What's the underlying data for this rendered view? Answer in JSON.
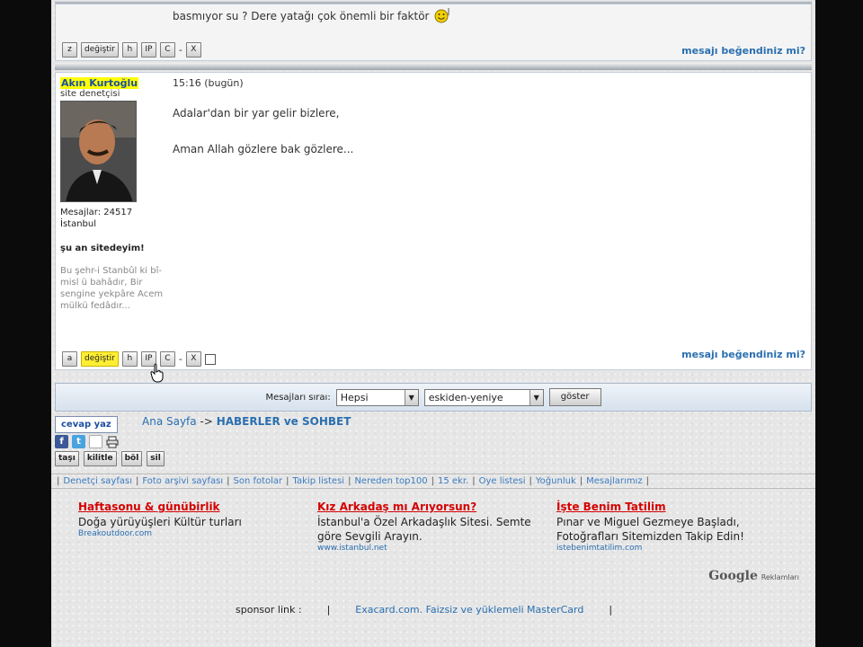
{
  "prev_post": {
    "text_line": "basmıyor su ? Dere yatağı çok önemli bir faktör",
    "emoji": "smiley-icon",
    "buttons": [
      "z",
      "değiştir",
      "h",
      "IP",
      "C",
      "X"
    ],
    "liked_link": "mesajı beğendiniz mi?"
  },
  "post": {
    "user_name": "Akın Kurtoğlu",
    "user_role": "site denetçisi",
    "messages_count": "Mesajlar: 24517",
    "location": "İstanbul",
    "online_status": "şu an sitedeyim!",
    "signature": "Bu şehr-i Stanbûl ki bî-misl ü bahâdır, Bir sengine yekpâre Acem mülkü fedâdır...",
    "time": "15:16 (bugün)",
    "lines": [
      "Adalar'dan bir yar gelir bizlere,",
      "Aman Allah gözlere bak gözlere..."
    ],
    "buttons": [
      "a",
      "değiştir",
      "h",
      "IP",
      "C",
      "X"
    ],
    "liked_link": "mesajı beğendiniz mi?"
  },
  "sort_bar": {
    "label": "Mesajları sıraı:",
    "select1": "Hepsi",
    "select2": "eskiden-yeniye",
    "go": "göster"
  },
  "nav": {
    "reply": "cevap yaz",
    "breadcrumb_home": "Ana Sayfa",
    "breadcrumb_arrow": "->",
    "breadcrumb_section": "HABERLER ve SOHBET",
    "share_icons": [
      "facebook-icon",
      "twitter-icon",
      "email-icon",
      "print-icon"
    ],
    "mini_buttons": [
      "taşı",
      "kilitle",
      "böl",
      "sil"
    ]
  },
  "links": [
    "Denetçi sayfası",
    "Foto arşivi sayfası",
    "Son fotolar",
    "Takip listesi",
    "Nereden top100",
    "15 ekr.",
    "Oye listesi",
    "Yoğunluk",
    "Mesajlarımız"
  ],
  "ads": [
    {
      "title": "Haftasonu & günübirlik",
      "text": "Doğa yürüyüşleri Kültür turları",
      "url": "Breakoutdoor.com"
    },
    {
      "title": "Kız Arkadaş mı Arıyorsun?",
      "text": "İstanbul'a Özel Arkadaşlık Sitesi. Semte göre Sevgili Arayın.",
      "url": "www.istanbul.net"
    },
    {
      "title": "İşte Benim Tatilim",
      "text": "Pınar ve Miguel Gezmeye Başladı, Fotoğrafları Sitemizden Takip Edin!",
      "url": "istebenimtatilim.com"
    }
  ],
  "google": {
    "brand": "Google",
    "label": "Reklamları"
  },
  "sponsor": {
    "label": "sponsor link :",
    "pipe": "|",
    "link": "Exacard.com. Faizsiz ve yüklemeli MasterCard"
  },
  "colors": {
    "accent": "#2a6fb0",
    "highlight": "#ffff00",
    "ad_title": "#d40000"
  }
}
